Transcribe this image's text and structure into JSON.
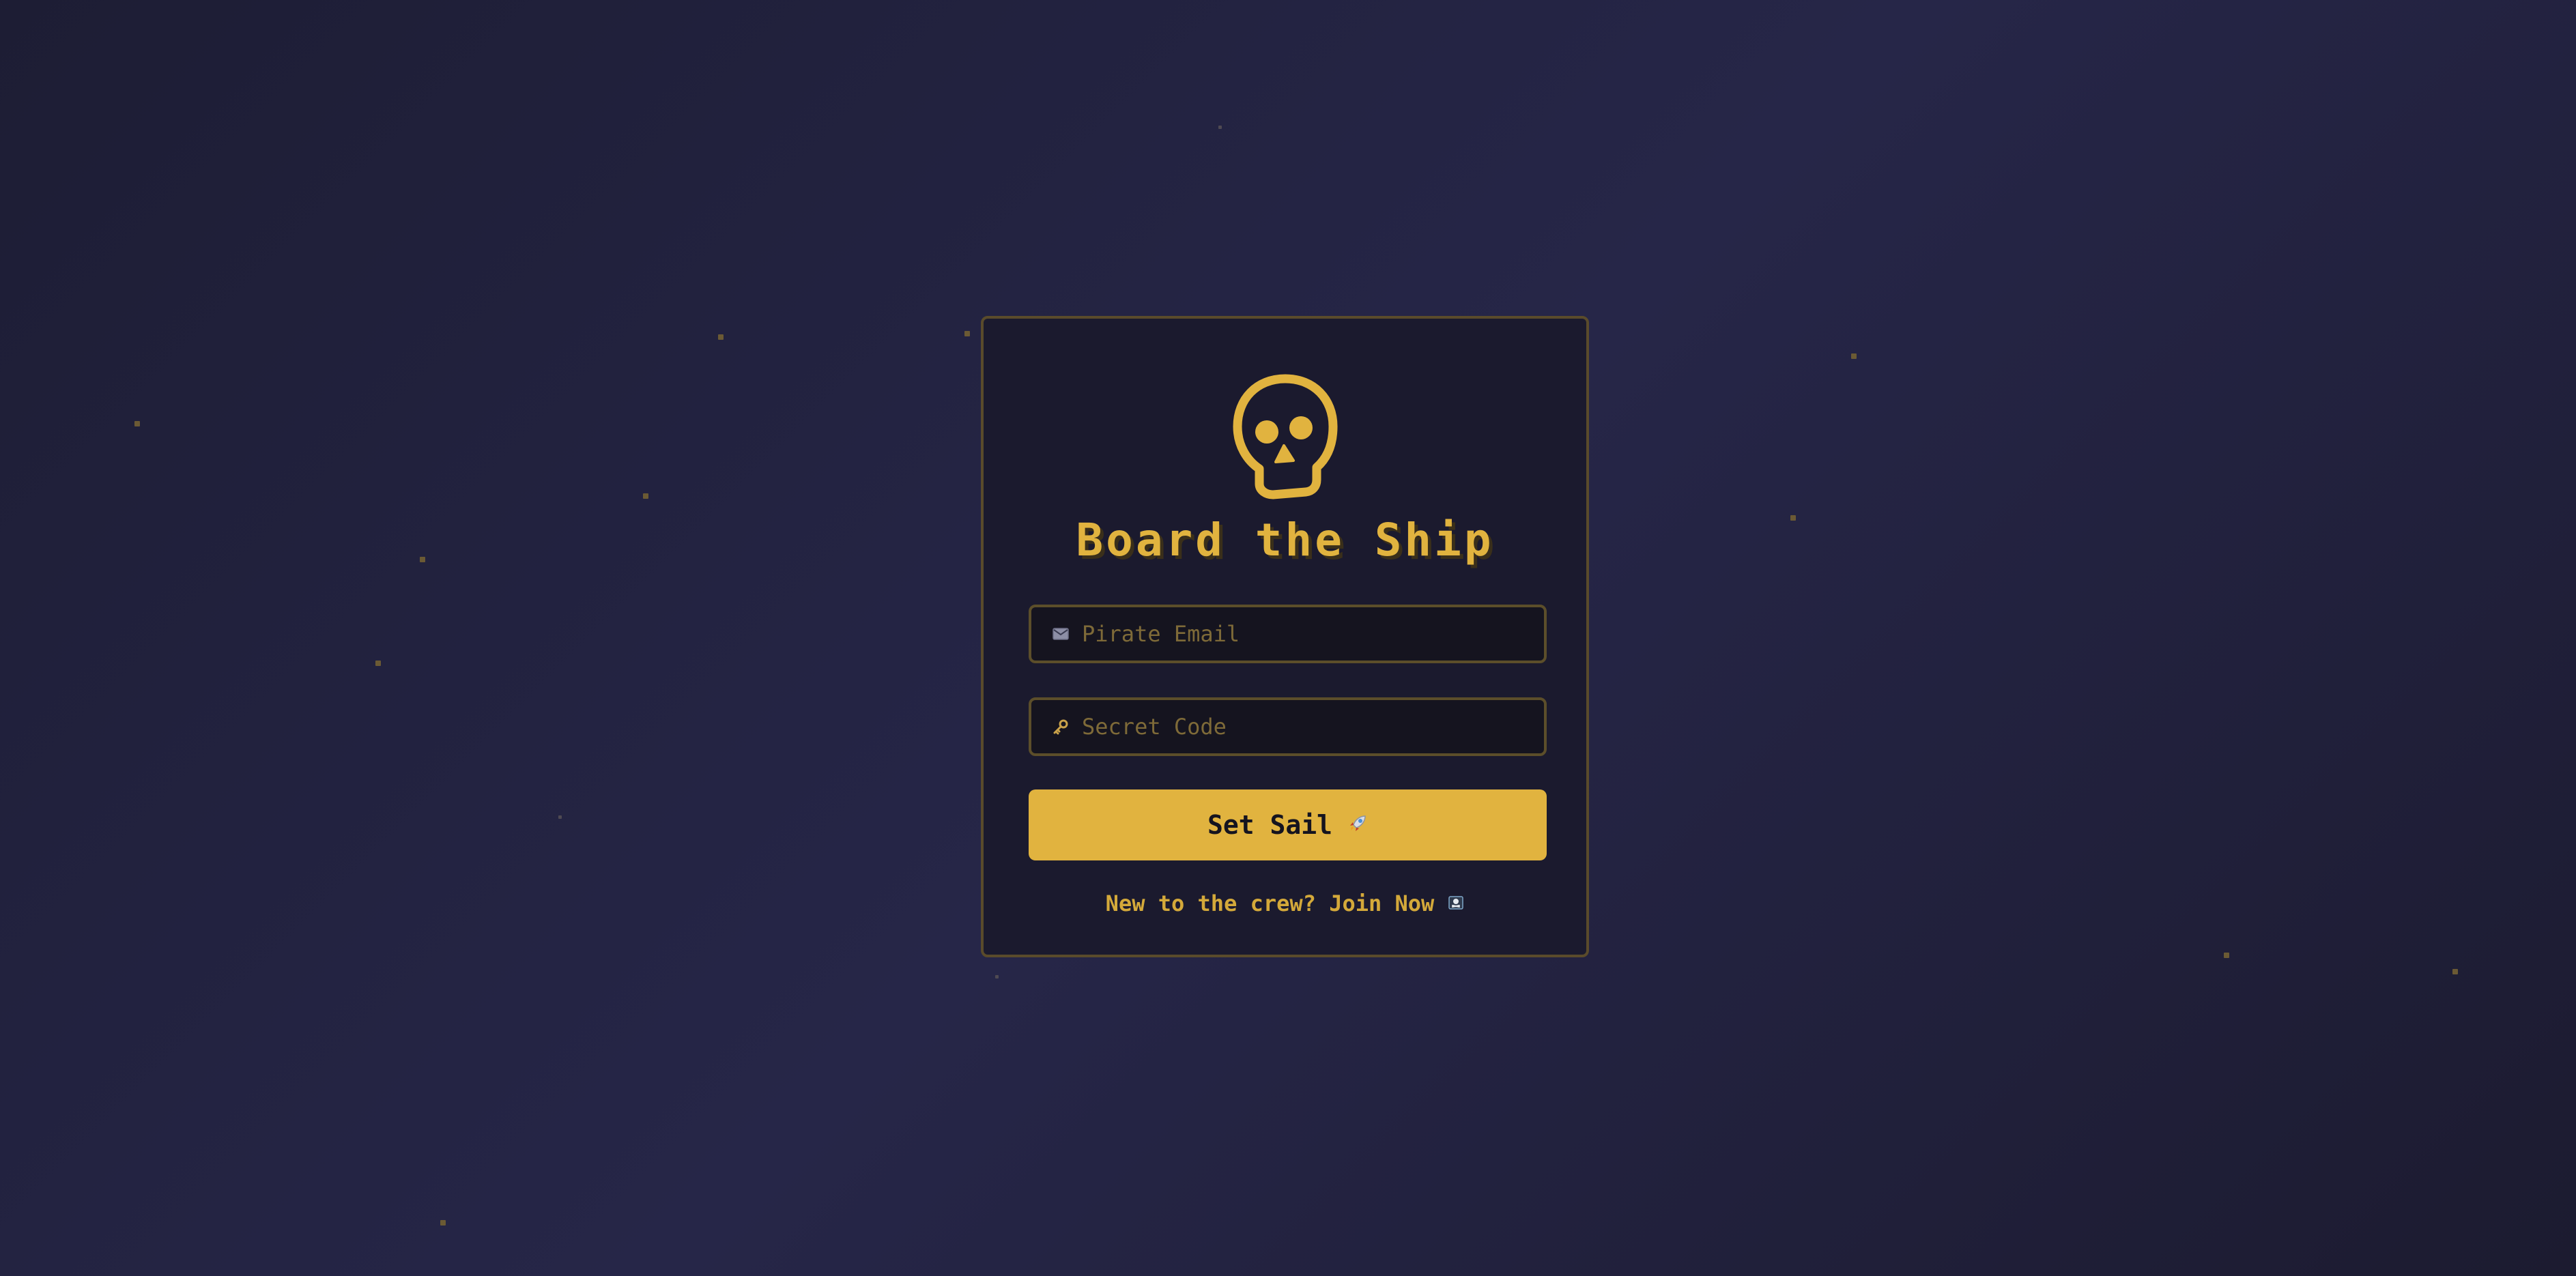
{
  "login": {
    "title": "Board the Ship",
    "email_placeholder": "Pirate Email",
    "password_placeholder": "Secret Code",
    "submit_label": "Set Sail",
    "signup_text": "New to the crew? Join Now",
    "icons": {
      "logo": "skull-icon",
      "email": "envelope-icon",
      "password": "key-icon",
      "submit": "rocket-icon",
      "signup": "pirate-flag-icon"
    }
  },
  "colors": {
    "accent": "#e1b33f",
    "card_background": "#1b1a2e",
    "page_background": "#262648",
    "border": "#5a4b2b"
  }
}
